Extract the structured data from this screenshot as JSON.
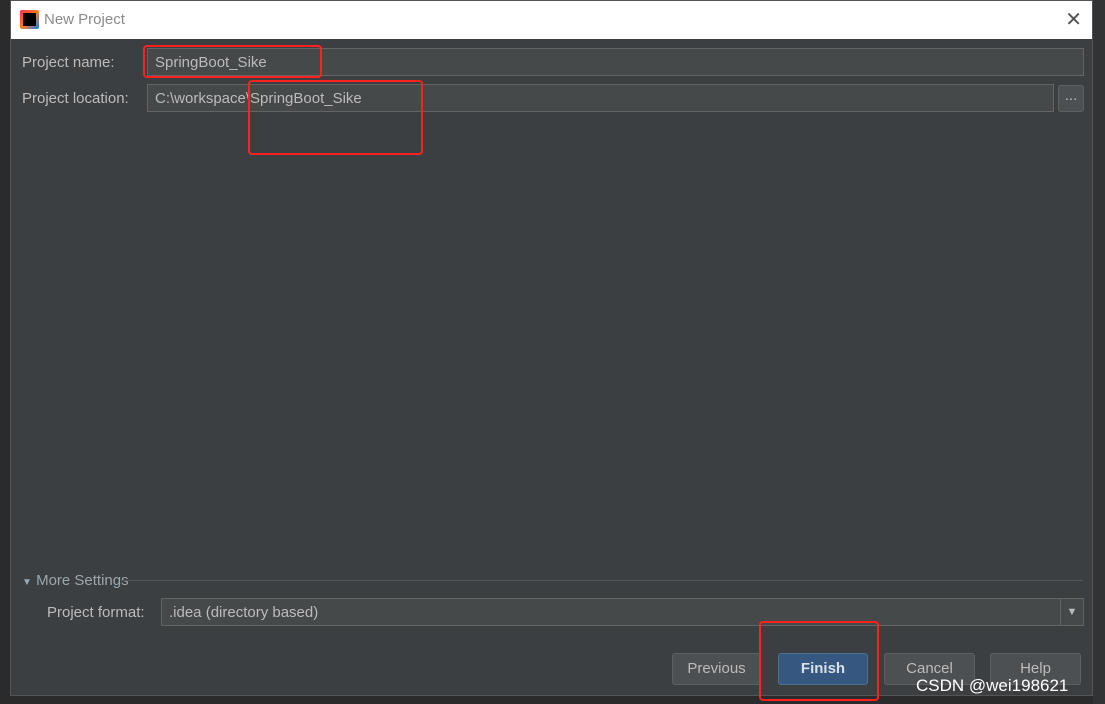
{
  "dialog": {
    "title": "New Project",
    "close_icon": "close-icon"
  },
  "form": {
    "name_label": "Project name:",
    "name_value": "SpringBoot_Sike",
    "location_label": "Project location:",
    "location_value": "C:\\workspace\\SpringBoot_Sike",
    "browse_label": "..."
  },
  "more_settings": {
    "label": "More Settings",
    "format_label": "Project format:",
    "format_value": ".idea (directory based)"
  },
  "buttons": {
    "previous": "Previous",
    "finish": "Finish",
    "cancel": "Cancel",
    "help": "Help"
  },
  "watermark": "CSDN @wei198621",
  "colors": {
    "highlight": "#ff2020",
    "primary_button": "#365880",
    "dialog_bg": "#3c3f41"
  }
}
